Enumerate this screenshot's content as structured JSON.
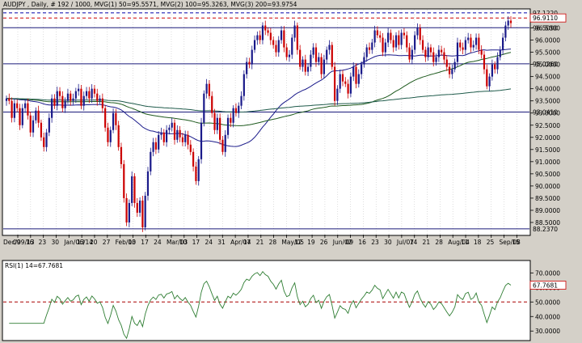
{
  "window": {
    "header": "AUDJPY , Daily, # 192 / 1000, MVG(1) 50=95.5571, MVG(2) 100=95.3263, MVG(3) 200=93.9754"
  },
  "chart_data": [
    {
      "type": "candlestick",
      "title": "AUDJPY , Daily, # 192 / 1000, MVG(1) 50=95.5571, MVG(2) 100=95.3263, MVG(3) 200=93.9754",
      "symbol": "AUDJPY",
      "timeframe": "Daily",
      "ylim": [
        88.0,
        97.25
      ],
      "yticks": [
        "96.5000",
        "96.0000",
        "95.5000",
        "95.0000",
        "94.5000",
        "94.0000",
        "93.5000",
        "93.0000",
        "92.5000",
        "92.0000",
        "91.5000",
        "91.0000",
        "90.5000",
        "90.0000",
        "89.5000",
        "89.0000",
        "88.5000"
      ],
      "xlabels": [
        "09",
        "16",
        "23",
        "30",
        "Jan/06/14",
        "13",
        "20",
        "27",
        "Feb/03",
        "10",
        "17",
        "24",
        "Mar/03",
        "10",
        "17",
        "24",
        "31",
        "Apr/07",
        "14",
        "21",
        "28",
        "May/05",
        "12",
        "19",
        "26",
        "Jun/02",
        "09",
        "16",
        "23",
        "30",
        "Jul/07",
        "14",
        "21",
        "28",
        "Aug/04",
        "11",
        "18",
        "25",
        "Sep/08",
        "15"
      ],
      "xlabel_first": "Dec/09/13",
      "horizontal_lines": [
        {
          "value": 97.122,
          "label": "97.1220",
          "style": "dashed",
          "color": "#0000aa"
        },
        {
          "value": 96.911,
          "label": "96.9110",
          "style": "dashed",
          "color": "#cc0000",
          "boxed": true
        },
        {
          "value": 96.509,
          "label": "96.5090",
          "style": "solid",
          "color": "#1a1a7a"
        },
        {
          "value": 95.026,
          "label": "95.0260",
          "style": "solid",
          "color": "#1a1a7a"
        },
        {
          "value": 93.041,
          "label": "93.0410",
          "style": "solid",
          "color": "#1a1a7a"
        },
        {
          "value": 88.237,
          "label": "88.2370",
          "style": "solid",
          "color": "#1a1a7a"
        }
      ],
      "closes": [
        93.6,
        93.5,
        92.8,
        93.4,
        93.2,
        92.5,
        93.2,
        93.4,
        92.9,
        92.2,
        92.7,
        93.1,
        92.6,
        92.0,
        91.6,
        92.2,
        92.8,
        93.6,
        93.3,
        93.9,
        93.7,
        93.2,
        93.5,
        93.8,
        93.5,
        93.6,
        93.9,
        94.0,
        93.3,
        93.7,
        93.9,
        93.6,
        94.0,
        93.8,
        93.5,
        93.6,
        93.2,
        92.4,
        91.8,
        92.3,
        93.0,
        92.5,
        91.6,
        90.9,
        89.5,
        88.5,
        89.3,
        90.4,
        89.3,
        88.9,
        89.4,
        88.3,
        89.6,
        90.6,
        91.4,
        91.8,
        91.5,
        92.1,
        92.2,
        91.8,
        92.3,
        92.4,
        92.6,
        91.9,
        92.3,
        92.0,
        91.8,
        92.1,
        91.7,
        91.4,
        90.8,
        90.2,
        91.1,
        92.6,
        93.8,
        94.2,
        93.7,
        93.0,
        92.3,
        92.8,
        91.9,
        91.4,
        92.1,
        92.8,
        92.6,
        93.2,
        93.0,
        93.3,
        93.7,
        94.6,
        95.1,
        95.0,
        95.6,
        96.0,
        96.2,
        96.0,
        96.6,
        96.4,
        96.3,
        96.0,
        95.8,
        95.5,
        96.0,
        96.4,
        95.7,
        95.3,
        95.4,
        96.1,
        96.6,
        95.6,
        94.9,
        95.2,
        94.7,
        94.9,
        95.4,
        95.7,
        95.1,
        95.3,
        94.6,
        95.2,
        95.6,
        95.8,
        94.9,
        93.5,
        94.0,
        94.6,
        94.3,
        94.2,
        93.8,
        94.5,
        94.9,
        94.2,
        94.6,
        95.0,
        95.3,
        95.7,
        95.6,
        95.9,
        96.4,
        96.2,
        96.1,
        95.5,
        95.9,
        96.3,
        96.0,
        95.7,
        96.2,
        95.8,
        96.3,
        96.2,
        95.7,
        95.2,
        95.6,
        96.2,
        96.5,
        96.0,
        95.6,
        95.3,
        95.7,
        95.5,
        95.1,
        95.3,
        95.6,
        95.5,
        95.2,
        94.9,
        94.6,
        94.8,
        95.1,
        95.9,
        95.7,
        95.6,
        96.0,
        96.1,
        95.7,
        95.8,
        96.1,
        95.6,
        95.4,
        94.8,
        94.1,
        94.5,
        95.0,
        94.8,
        95.3,
        95.6,
        96.1,
        96.6,
        96.8,
        96.7
      ],
      "ma": [
        {
          "name": "MVG(1) 50",
          "period": 50,
          "value": 95.5571,
          "color": "#1a1a8a"
        },
        {
          "name": "MVG(2) 100",
          "period": 100,
          "value": 95.3263,
          "color": "#1e5a1e"
        },
        {
          "name": "MVG(3) 200",
          "period": 200,
          "value": 93.9754,
          "color": "#1e5a4a"
        }
      ],
      "up_color": "#1a1a8a",
      "down_color": "#cc0000"
    },
    {
      "type": "line",
      "title": "RSI(1) 14=67.7681",
      "series": [
        {
          "name": "RSI(1) 14",
          "color": "#2e7d32"
        }
      ],
      "last_value": "67.7681",
      "yticks": [
        "70.0000",
        "60.0000",
        "50.0000",
        "40.0000",
        "30.0000"
      ],
      "ylim": [
        24,
        78
      ],
      "reference_level": 50
    }
  ]
}
